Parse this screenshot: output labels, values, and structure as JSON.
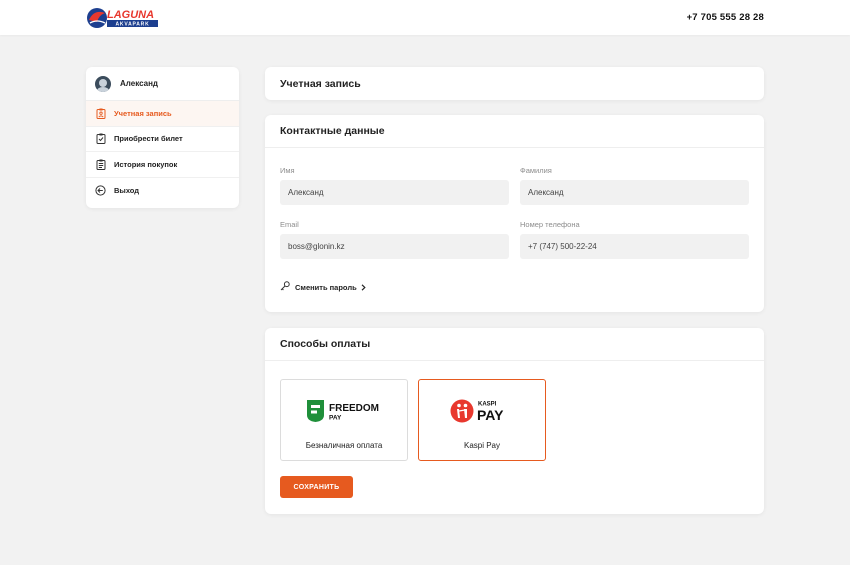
{
  "header": {
    "logo_text": "LAGUNA",
    "logo_subtext": "AKVAPARK",
    "phone": "+7 705 555 28 28"
  },
  "sidebar": {
    "user_name": "Александ",
    "items": [
      {
        "label": "Учетная запись",
        "icon": "profile-card-icon",
        "active": true
      },
      {
        "label": "Приобрести билет",
        "icon": "ticket-icon",
        "active": false
      },
      {
        "label": "История покупок",
        "icon": "history-list-icon",
        "active": false
      },
      {
        "label": "Выход",
        "icon": "logout-arrow-icon",
        "active": false
      }
    ]
  },
  "account": {
    "title": "Учетная запись"
  },
  "contacts": {
    "title": "Контактные данные",
    "first_name_label": "Имя",
    "first_name_value": "Александ",
    "last_name_label": "Фамилия",
    "last_name_value": "Александ",
    "email_label": "Email",
    "email_value": "boss@glonin.kz",
    "phone_label": "Номер телефона",
    "phone_value": "+7 (747) 500-22-24",
    "change_password": "Сменить пароль"
  },
  "payment": {
    "title": "Способы оплаты",
    "options": [
      {
        "name": "Безналичная оплата",
        "logo_line1": "FREEDOM",
        "logo_line2": "PAY",
        "selected": false
      },
      {
        "name": "Kaspi Pay",
        "logo_line1": "KASPI",
        "logo_line2": "PAY",
        "selected": true
      }
    ],
    "save_label": "СОХРАНИТЬ"
  },
  "colors": {
    "accent": "#e65a1f",
    "background": "#f2f2f2",
    "freedom_green": "#1f8f3a",
    "kaspi_red": "#e8382e",
    "logo_blue": "#1d3f8f"
  }
}
